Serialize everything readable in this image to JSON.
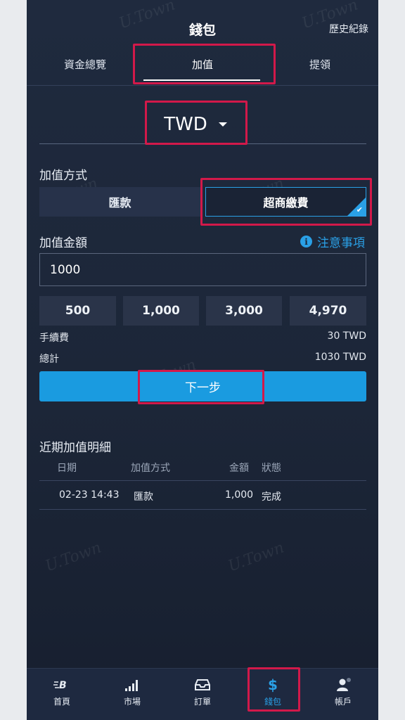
{
  "header": {
    "title": "錢包",
    "history_label": "歷史紀錄"
  },
  "tabs": [
    {
      "label": "資金總覽"
    },
    {
      "label": "加值"
    },
    {
      "label": "提領"
    }
  ],
  "currency": {
    "selected": "TWD"
  },
  "deposit_method": {
    "label": "加值方式",
    "options": [
      {
        "label": "匯款"
      },
      {
        "label": "超商繳費"
      }
    ],
    "selected": "超商繳費"
  },
  "amount": {
    "label": "加值金額",
    "notes_label": "注意事項",
    "value": "1000",
    "presets": [
      "500",
      "1,000",
      "3,000",
      "4,970"
    ]
  },
  "summary": {
    "fee_label": "手續費",
    "fee_value": "30 TWD",
    "total_label": "總計",
    "total_value": "1030 TWD"
  },
  "next_button": {
    "label": "下一步"
  },
  "recent": {
    "title": "近期加值明細",
    "columns": [
      "日期",
      "加值方式",
      "金額",
      "狀態"
    ],
    "rows": [
      {
        "date": "02-23 14:43",
        "method": "匯款",
        "amount": "1,000",
        "status": "完成"
      }
    ]
  },
  "watermark": "U.Town",
  "bottom_nav": [
    {
      "label": "首頁",
      "icon": "logo-icon"
    },
    {
      "label": "市場",
      "icon": "signal-bars-icon"
    },
    {
      "label": "訂單",
      "icon": "inbox-icon"
    },
    {
      "label": "錢包",
      "icon": "dollar-icon"
    },
    {
      "label": "帳戶",
      "icon": "user-icon"
    }
  ],
  "colors": {
    "accent": "#1a9be0",
    "highlight": "#d2194a",
    "background": "#1f2a3e"
  }
}
